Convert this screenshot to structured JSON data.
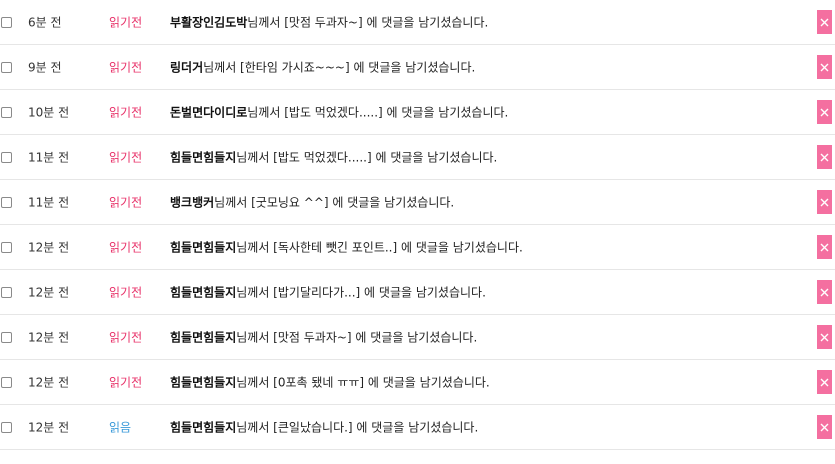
{
  "notifications": [
    {
      "time": "6분 전",
      "status": "읽기전",
      "read": false,
      "nick": "부활장인김도박",
      "suffix": "님께서 [맛점 두과자~] 에 댓글을 남기셨습니다."
    },
    {
      "time": "9분 전",
      "status": "읽기전",
      "read": false,
      "nick": "링더거",
      "suffix": "님께서 [한타임 가시죠~~~] 에 댓글을 남기셨습니다."
    },
    {
      "time": "10분 전",
      "status": "읽기전",
      "read": false,
      "nick": "돈벌면다이디로",
      "suffix": "님께서 [밥도 먹었겠다.....] 에 댓글을 남기셨습니다."
    },
    {
      "time": "11분 전",
      "status": "읽기전",
      "read": false,
      "nick": "힘들면힘들지",
      "suffix": "님께서 [밥도 먹었겠다.....] 에 댓글을 남기셨습니다."
    },
    {
      "time": "11분 전",
      "status": "읽기전",
      "read": false,
      "nick": "뱅크뱅커",
      "suffix": "님께서 [굿모닝요 ^^] 에 댓글을 남기셨습니다."
    },
    {
      "time": "12분 전",
      "status": "읽기전",
      "read": false,
      "nick": "힘들면힘들지",
      "suffix": "님께서 [독사한테 뺏긴 포인트..] 에 댓글을 남기셨습니다."
    },
    {
      "time": "12분 전",
      "status": "읽기전",
      "read": false,
      "nick": "힘들면힘들지",
      "suffix": "님께서 [밥기달리다가...] 에 댓글을 남기셨습니다."
    },
    {
      "time": "12분 전",
      "status": "읽기전",
      "read": false,
      "nick": "힘들면힘들지",
      "suffix": "님께서 [맛점 두과자~] 에 댓글을 남기셨습니다."
    },
    {
      "time": "12분 전",
      "status": "읽기전",
      "read": false,
      "nick": "힘들면힘들지",
      "suffix": "님께서 [0포촉 됐네 ㅠㅠ] 에 댓글을 남기셨습니다."
    },
    {
      "time": "12분 전",
      "status": "읽음",
      "read": true,
      "nick": "힘들면힘들지",
      "suffix": "님께서 [큰일났습니다.] 에 댓글을 남기셨습니다."
    }
  ],
  "colors": {
    "unread": "#e8336a",
    "read": "#3a9ad9",
    "delete_button": "#f46fa0"
  },
  "icons": {
    "checkbox": "checkbox-icon",
    "delete": "close-icon"
  }
}
